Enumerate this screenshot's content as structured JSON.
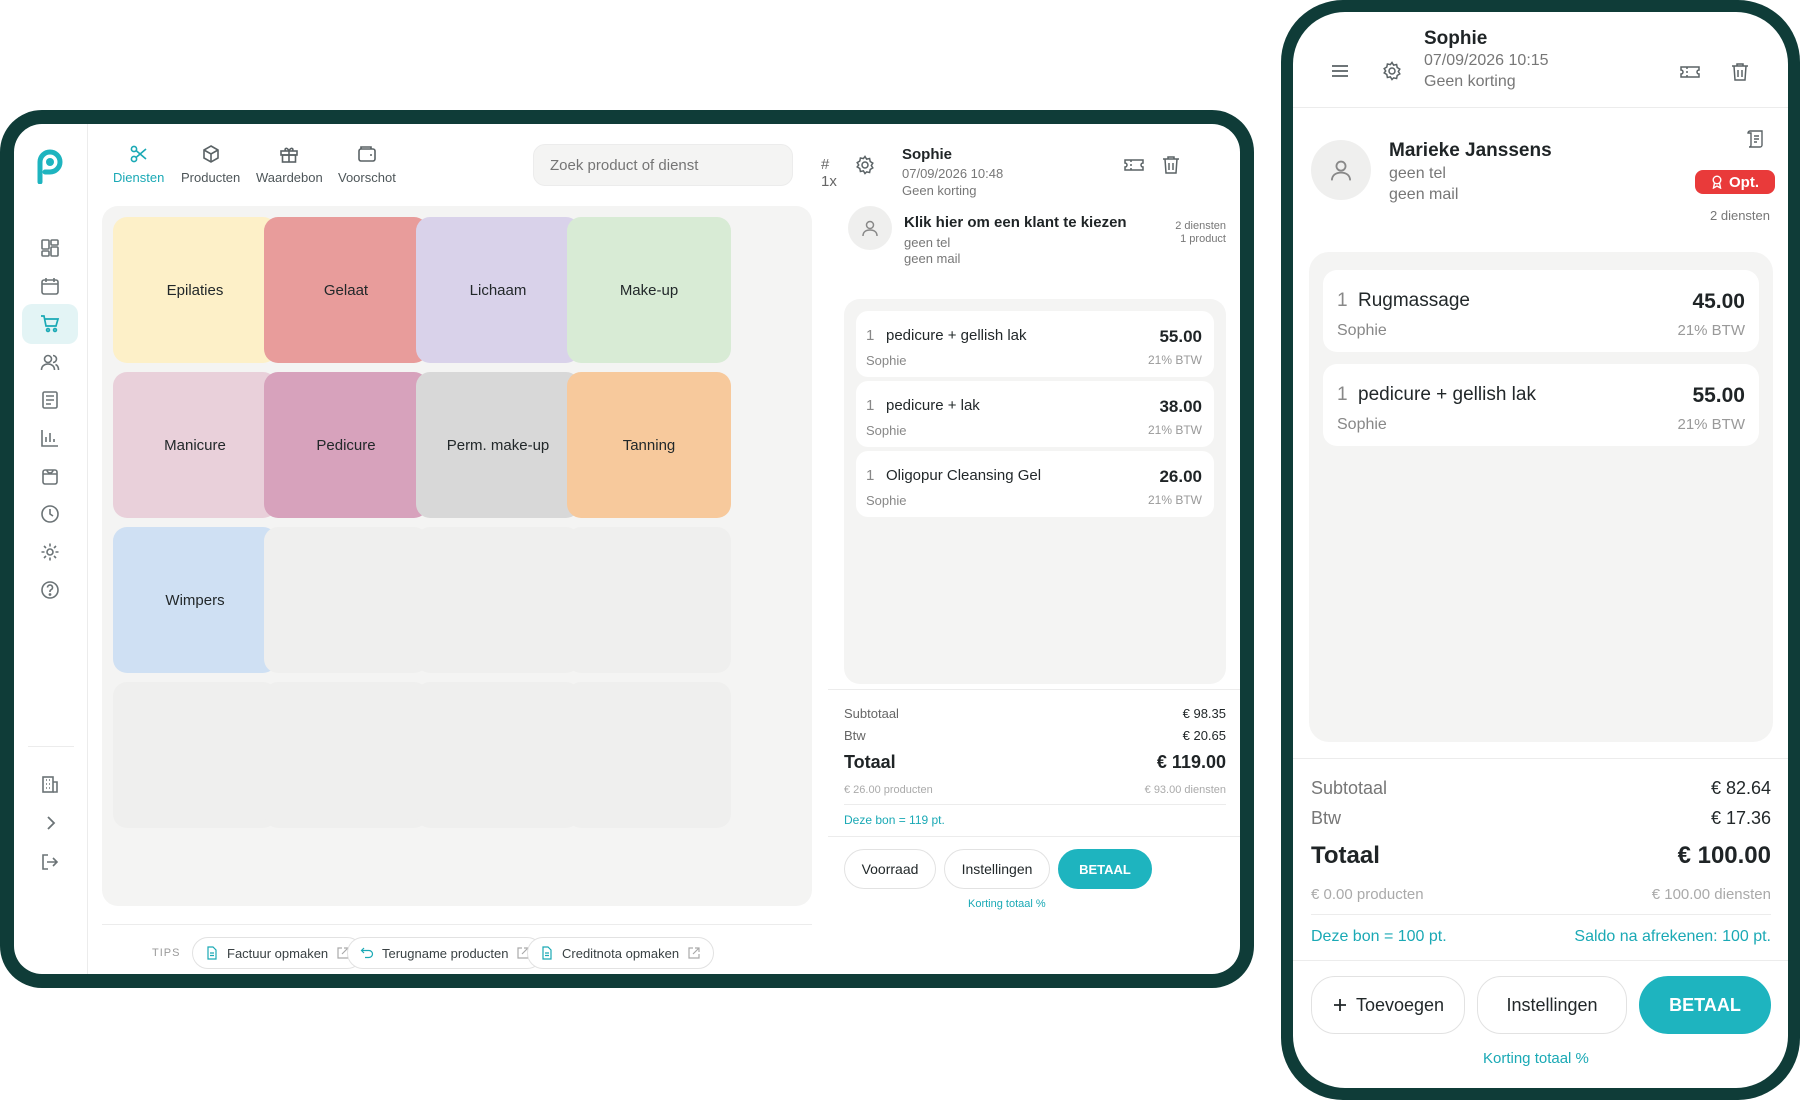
{
  "tablet": {
    "tabs": [
      {
        "label": "Diensten",
        "icon": "scissors-icon"
      },
      {
        "label": "Producten",
        "icon": "box-icon"
      },
      {
        "label": "Waardebon",
        "icon": "gift-icon"
      },
      {
        "label": "Voorschot",
        "icon": "wallet-icon"
      }
    ],
    "search_placeholder": "Zoek product of dienst",
    "quantity": "# 1x",
    "categories": [
      {
        "label": "Epilaties",
        "color": "#fdf0c8"
      },
      {
        "label": "Gelaat",
        "color": "#e89c9b"
      },
      {
        "label": "Lichaam",
        "color": "#d9d2ea"
      },
      {
        "label": "Make-up",
        "color": "#d8ebd5"
      },
      {
        "label": "Manicure",
        "color": "#e9d0da"
      },
      {
        "label": "Pedicure",
        "color": "#d7a2bc"
      },
      {
        "label": "Perm. make-up",
        "color": "#d8d8d8"
      },
      {
        "label": "Tanning",
        "color": "#f7c99c"
      },
      {
        "label": "Wimpers",
        "color": "#cfe0f3"
      }
    ],
    "tips": {
      "label": "TIPS",
      "items": [
        "Factuur opmaken",
        "Terugname producten",
        "Creditnota opmaken"
      ]
    },
    "ticket": {
      "employee": "Sophie",
      "datetime": "07/09/2026 10:48",
      "discount": "Geen korting",
      "customer_prompt": "Klik hier om een klant te kiezen",
      "customer_phone": "geen tel",
      "customer_mail": "geen mail",
      "count_services": "2 diensten",
      "count_products": "1 product",
      "lines": [
        {
          "qty": "1",
          "name": "pedicure + gellish lak",
          "price": "55.00",
          "employee": "Sophie",
          "vat": "21% BTW"
        },
        {
          "qty": "1",
          "name": "pedicure + lak",
          "price": "38.00",
          "employee": "Sophie",
          "vat": "21% BTW"
        },
        {
          "qty": "1",
          "name": "Oligopur Cleansing Gel",
          "price": "26.00",
          "employee": "Sophie",
          "vat": "21% BTW"
        }
      ],
      "subtotal_label": "Subtotaal",
      "subtotal": "€ 98.35",
      "vat_label": "Btw",
      "vat": "€ 20.65",
      "total_label": "Totaal",
      "total": "€ 119.00",
      "products_amount": "€ 26.00 producten",
      "services_amount": "€ 93.00 diensten",
      "points": "Deze bon = 119 pt.",
      "btn_stock": "Voorraad",
      "btn_settings": "Instellingen",
      "btn_pay": "BETAAL",
      "discount_link": "Korting totaal %"
    }
  },
  "phone": {
    "employee": "Sophie",
    "datetime": "07/09/2026 10:15",
    "discount": "Geen korting",
    "customer_name": "Marieke Janssens",
    "customer_phone": "geen tel",
    "customer_mail": "geen mail",
    "badge": "Opt.",
    "count_services": "2 diensten",
    "lines": [
      {
        "qty": "1",
        "name": "Rugmassage",
        "price": "45.00",
        "employee": "Sophie",
        "vat": "21% BTW"
      },
      {
        "qty": "1",
        "name": "pedicure + gellish lak",
        "price": "55.00",
        "employee": "Sophie",
        "vat": "21% BTW"
      }
    ],
    "subtotal_label": "Subtotaal",
    "subtotal": "€ 82.64",
    "vat_label": "Btw",
    "vat": "€ 17.36",
    "total_label": "Totaal",
    "total": "€ 100.00",
    "products_amount": "€ 0.00 producten",
    "services_amount": "€ 100.00 diensten",
    "points": "Deze bon = 100 pt.",
    "balance": "Saldo na afrekenen: 100 pt.",
    "btn_add": "Toevoegen",
    "btn_settings": "Instellingen",
    "btn_pay": "BETAAL",
    "discount_link": "Korting totaal %"
  },
  "colors": {
    "accent": "#1eb4bf",
    "frame": "#0f3c38",
    "badge": "#e93a3a"
  }
}
